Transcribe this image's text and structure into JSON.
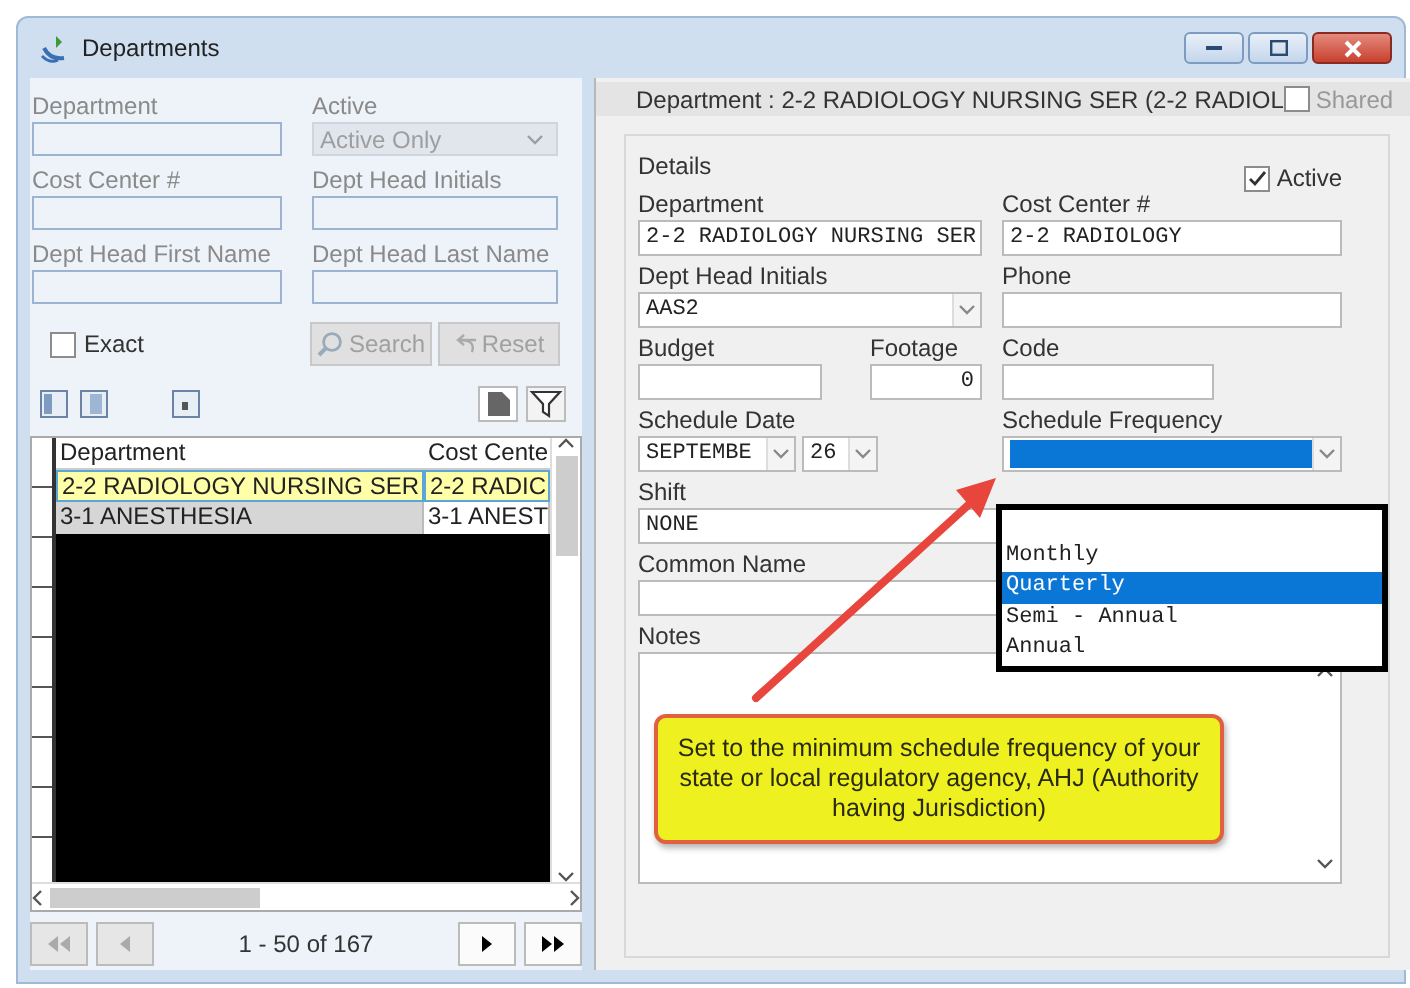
{
  "window": {
    "title": "Departments"
  },
  "filters": [
    {
      "label": "Department",
      "kind": "text"
    },
    {
      "label": "Active",
      "kind": "select",
      "value": "Active Only",
      "disabled": true
    },
    {
      "label": "Cost Center #",
      "kind": "text"
    },
    {
      "label": "Dept Head Initials",
      "kind": "text"
    },
    {
      "label": "Dept Head First Name",
      "kind": "text"
    },
    {
      "label": "Dept Head Last Name",
      "kind": "text"
    }
  ],
  "exact": {
    "label": "Exact",
    "checked": false
  },
  "filter_buttons": [
    {
      "label": "Search",
      "kind": "search",
      "disabled": true
    },
    {
      "label": "Reset",
      "kind": "reset",
      "disabled": true
    }
  ],
  "table": {
    "columns": [
      "Department",
      "Cost Cente"
    ],
    "rows": [
      {
        "cells": [
          "2-2 RADIOLOGY NURSING SER",
          "2-2 RADIC"
        ],
        "selected": true
      },
      {
        "cells": [
          "3-1 ANESTHESIA",
          "3-1 ANEST"
        ],
        "selected": false
      }
    ]
  },
  "pager": {
    "text": "1 - 50 of 167",
    "buttons": [
      {
        "kind": "first",
        "disabled": true
      },
      {
        "kind": "prev",
        "disabled": true
      },
      {
        "kind": "next",
        "disabled": false
      },
      {
        "kind": "last",
        "disabled": false
      }
    ]
  },
  "detail": {
    "header": "Department : 2-2 RADIOLOGY NURSING SER (2-2 RADIOL",
    "shared": {
      "label": "Shared",
      "checked": false
    },
    "group_title": "Details",
    "active": {
      "label": "Active",
      "checked": true
    },
    "fields": [
      {
        "label": "Department",
        "kind": "text",
        "value": "2-2 RADIOLOGY NURSING SER"
      },
      {
        "label": "Cost Center #",
        "kind": "text",
        "value": "2-2 RADIOLOGY"
      },
      {
        "label": "Dept Head Initials",
        "kind": "select",
        "value": "AAS2"
      },
      {
        "label": "Phone",
        "kind": "text"
      },
      {
        "label": "Budget",
        "kind": "text"
      },
      {
        "label": "Footage",
        "kind": "number",
        "value": "0"
      },
      {
        "label": "Code",
        "kind": "text"
      },
      {
        "label": "Schedule Date",
        "kind": "date",
        "month": "SEPTEMBE",
        "day": "26"
      },
      {
        "label": "Schedule Frequency",
        "kind": "dropdown",
        "open": true,
        "options": [
          {
            "selected": false
          },
          {
            "label": "Monthly",
            "selected": false
          },
          {
            "label": "Quarterly",
            "selected": true
          },
          {
            "label": "Semi - Annual",
            "selected": false
          },
          {
            "label": "Annual",
            "selected": false
          }
        ]
      },
      {
        "label": "Shift",
        "kind": "text",
        "value": "NONE"
      },
      {
        "label": "Common Name",
        "kind": "text"
      },
      {
        "label": "Notes",
        "kind": "textarea"
      }
    ]
  },
  "callout": {
    "text": "Set to the minimum schedule frequency of your state or local regulatory agency, AHJ (Authority having Jurisdiction)"
  }
}
